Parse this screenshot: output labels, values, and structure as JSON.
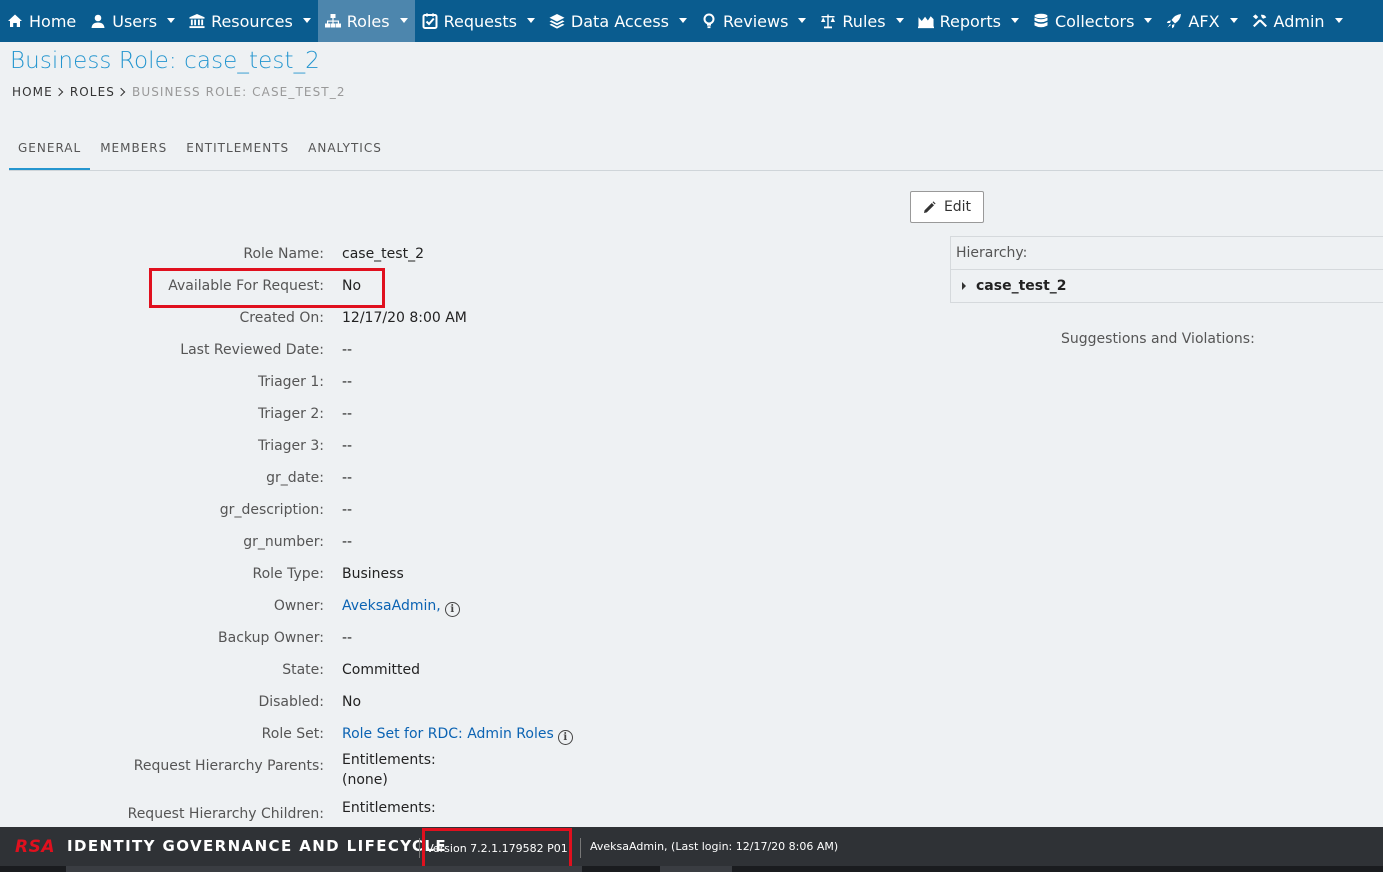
{
  "nav": {
    "items": [
      {
        "label": "Home",
        "icon": "home-icon",
        "caret": false,
        "active": false
      },
      {
        "label": "Users",
        "icon": "user-icon",
        "caret": true,
        "active": false
      },
      {
        "label": "Resources",
        "icon": "building-icon",
        "caret": true,
        "active": false
      },
      {
        "label": "Roles",
        "icon": "sitemap-icon",
        "caret": true,
        "active": true
      },
      {
        "label": "Requests",
        "icon": "checklist-icon",
        "caret": true,
        "active": false
      },
      {
        "label": "Data Access",
        "icon": "layers-icon",
        "caret": true,
        "active": false
      },
      {
        "label": "Reviews",
        "icon": "lightbulb-icon",
        "caret": true,
        "active": false
      },
      {
        "label": "Rules",
        "icon": "scales-icon",
        "caret": true,
        "active": false
      },
      {
        "label": "Reports",
        "icon": "chart-icon",
        "caret": true,
        "active": false
      },
      {
        "label": "Collectors",
        "icon": "database-icon",
        "caret": true,
        "active": false
      },
      {
        "label": "AFX",
        "icon": "rocket-icon",
        "caret": true,
        "active": false
      },
      {
        "label": "Admin",
        "icon": "tools-icon",
        "caret": true,
        "active": false
      }
    ]
  },
  "page": {
    "title": "Business Role: case_test_2",
    "breadcrumb": [
      "HOME",
      "ROLES",
      "BUSINESS ROLE: CASE_TEST_2"
    ]
  },
  "tabs": [
    "GENERAL",
    "MEMBERS",
    "ENTITLEMENTS",
    "ANALYTICS"
  ],
  "edit_label": "Edit",
  "fields": [
    {
      "label": "Role Name:",
      "value": "case_test_2"
    },
    {
      "label": "Available For Request:",
      "value": "No"
    },
    {
      "label": "Created On:",
      "value": "12/17/20 8:00 AM"
    },
    {
      "label": "Last Reviewed Date:",
      "value": "--"
    },
    {
      "label": "Triager 1:",
      "value": "--"
    },
    {
      "label": "Triager 2:",
      "value": "--"
    },
    {
      "label": "Triager 3:",
      "value": "--"
    },
    {
      "label": "gr_date:",
      "value": "--"
    },
    {
      "label": "gr_description:",
      "value": "--"
    },
    {
      "label": "gr_number:",
      "value": "--"
    },
    {
      "label": "Role Type:",
      "value": "Business"
    },
    {
      "label": "Owner:",
      "value": "AveksaAdmin,",
      "link": true,
      "info": true
    },
    {
      "label": "Backup Owner:",
      "value": "--"
    },
    {
      "label": "State:",
      "value": "Committed"
    },
    {
      "label": "Disabled:",
      "value": "No"
    },
    {
      "label": "Role Set:",
      "value": "Role Set for RDC: Admin Roles",
      "link": true,
      "info": true
    },
    {
      "label": "Request Hierarchy Parents:",
      "value": "Entitlements:",
      "value2": "(none)",
      "tall": true
    },
    {
      "label": "Request Hierarchy Children:",
      "value": "Entitlements:",
      "tall": true
    }
  ],
  "hierarchy": {
    "heading": "Hierarchy:",
    "node": "case_test_2"
  },
  "suggestions_label": "Suggestions and Violations:",
  "footer": {
    "logo": "RSA",
    "brand": "IDENTITY GOVERNANCE AND LIFECYCLE",
    "version": "Version 7.2.1.179582 P01",
    "user": "AveksaAdmin,  (Last login: 12/17/20 8:06 AM)"
  },
  "colors": {
    "nav_bg": "#0a5c8f",
    "nav_active": "#4d86ad",
    "accent": "#2596cf",
    "link": "#0b63b3",
    "highlight": "#e0101e"
  }
}
